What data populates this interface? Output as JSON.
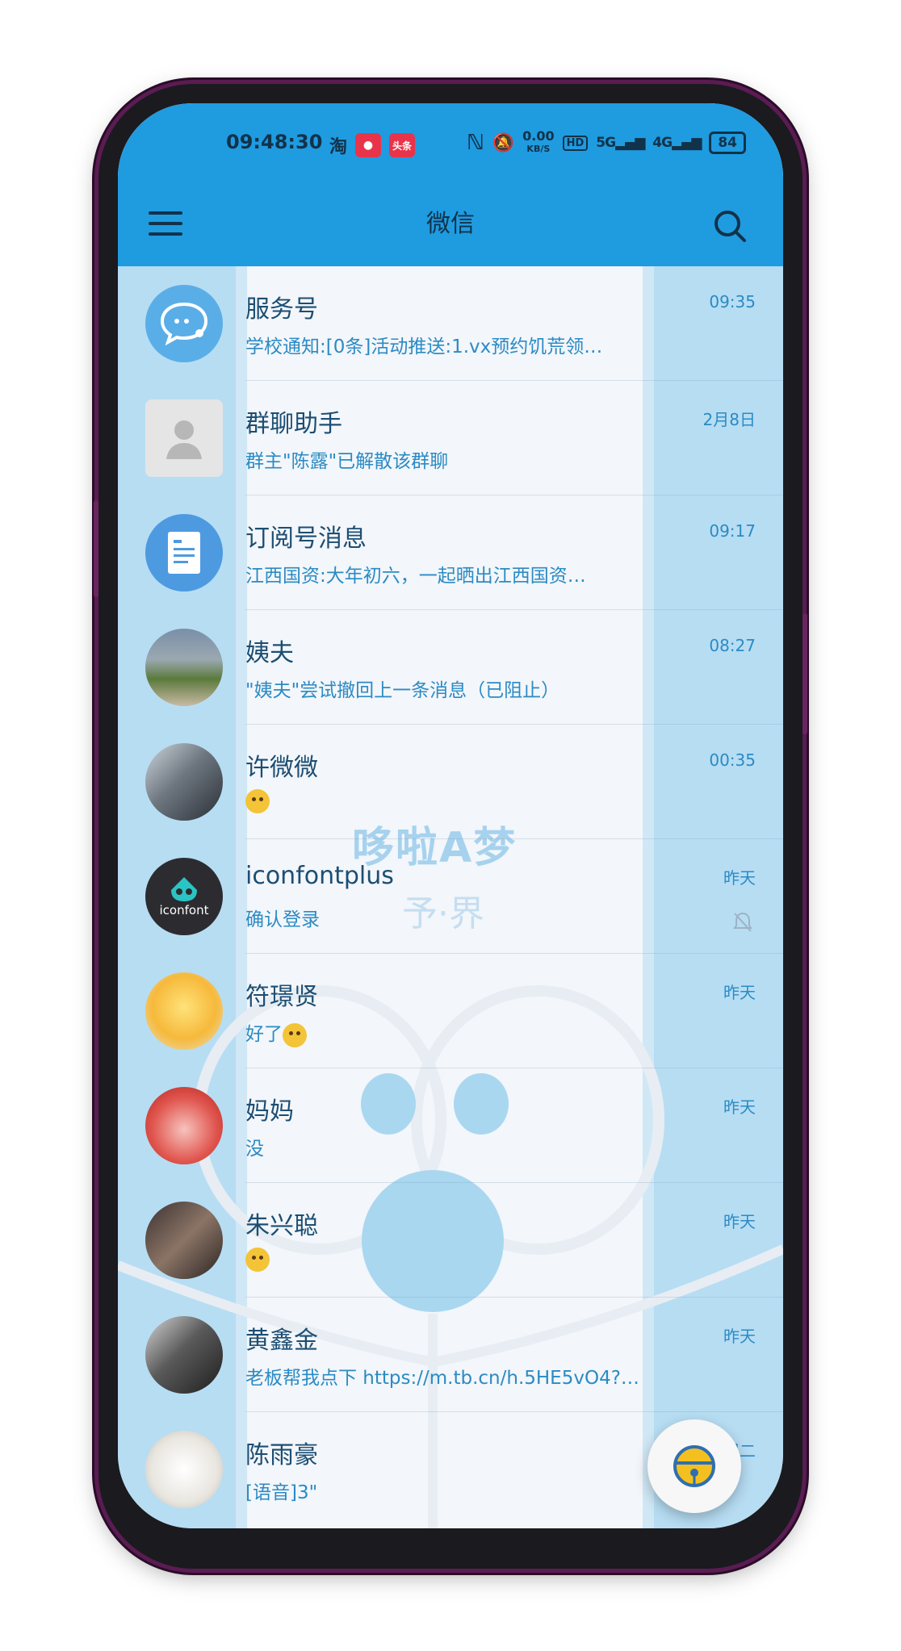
{
  "status_bar": {
    "time": "09:48:30",
    "app_icons": [
      "淘",
      "头条"
    ],
    "net_speed": "0.00",
    "net_speed_unit": "KB/S",
    "hd": "HD",
    "signal_1": "5G",
    "signal_2": "4G",
    "battery": "84"
  },
  "title_bar": {
    "title": "微信"
  },
  "chats": [
    {
      "name": "服务号",
      "message": "学校通知:[0条]活动推送:1.vx预约饥荒领…",
      "time": "09:35",
      "avatar": "service-icon"
    },
    {
      "name": "群聊助手",
      "message": "群主\"陈露\"已解散该群聊",
      "time": "2月8日",
      "avatar": "person-placeholder-icon"
    },
    {
      "name": "订阅号消息",
      "message": "江西国资:大年初六，一起晒出江西国资…",
      "time": "09:17",
      "avatar": "subscription-icon"
    },
    {
      "name": "姨夫",
      "message": "\"姨夫\"尝试撤回上一条消息（已阻止）",
      "time": "08:27",
      "avatar": "photo"
    },
    {
      "name": "许微微",
      "message": "",
      "time": "00:35",
      "avatar": "photo",
      "emoji": true
    },
    {
      "name": "iconfontplus",
      "message": "确认登录",
      "time": "昨天",
      "avatar": "iconfont-logo",
      "muted": true,
      "avatar_text": "iconfont"
    },
    {
      "name": "符璟贤",
      "message": "好了",
      "time": "昨天",
      "avatar": "cartoon",
      "emoji": true
    },
    {
      "name": "妈妈",
      "message": "没",
      "time": "昨天",
      "avatar": "photo"
    },
    {
      "name": "朱兴聪",
      "message": "",
      "time": "昨天",
      "avatar": "photo",
      "emoji": true
    },
    {
      "name": "黄鑫金",
      "message": "老板帮我点下 https://m.tb.cn/h.5HE5vO4?t…",
      "time": "昨天",
      "avatar": "photo"
    },
    {
      "name": "陈雨豪",
      "message": "[语音]3\"",
      "time": "周二",
      "avatar": "sketch"
    }
  ],
  "watermark": {
    "logo_text": "哆啦A梦",
    "sub_text": "予·界"
  },
  "colors": {
    "header": "#1f9be0",
    "text_primary": "#1c4e73",
    "text_secondary": "#2b8bc4"
  },
  "fab": {
    "icon": "bell-icon"
  }
}
